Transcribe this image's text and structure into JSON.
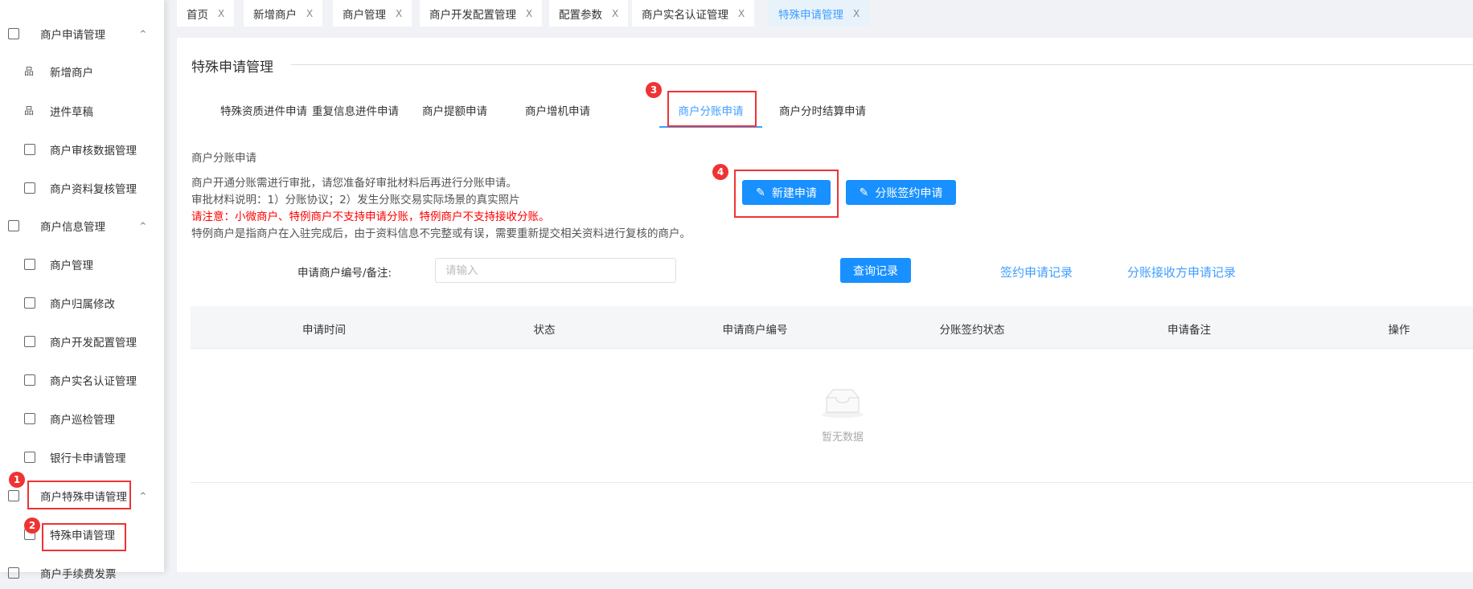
{
  "sidebar": {
    "items": [
      {
        "label": "商户申请管理",
        "type": "group"
      },
      {
        "label": "新增商户",
        "type": "sub"
      },
      {
        "label": "进件草稿",
        "type": "sub"
      },
      {
        "label": "商户审核数据管理",
        "type": "sub"
      },
      {
        "label": "商户资料复核管理",
        "type": "sub"
      },
      {
        "label": "商户信息管理",
        "type": "group"
      },
      {
        "label": "商户管理",
        "type": "sub"
      },
      {
        "label": "商户归属修改",
        "type": "sub"
      },
      {
        "label": "商户开发配置管理",
        "type": "sub"
      },
      {
        "label": "商户实名认证管理",
        "type": "sub"
      },
      {
        "label": "商户巡检管理",
        "type": "sub"
      },
      {
        "label": "银行卡申请管理",
        "type": "sub"
      },
      {
        "label": "商户特殊申请管理",
        "type": "group"
      },
      {
        "label": "特殊申请管理",
        "type": "sub"
      },
      {
        "label": "商户手续费发票",
        "type": "group"
      }
    ]
  },
  "tabs": [
    {
      "label": "首页"
    },
    {
      "label": "新增商户"
    },
    {
      "label": "商户管理"
    },
    {
      "label": "商户开发配置管理"
    },
    {
      "label": "配置参数"
    },
    {
      "label": "商户实名认证管理"
    },
    {
      "label": "特殊申请管理",
      "active": true
    }
  ],
  "tab_close": "X",
  "page": {
    "title": "特殊申请管理",
    "subtabs": [
      "特殊资质进件申请",
      "重复信息进件申请",
      "商户提额申请",
      "商户增机申请",
      "商户分账申请",
      "商户分时结算申请"
    ],
    "section_title": "商户分账申请",
    "notes": [
      "商户开通分账需进行审批，请您准备好审批材料后再进行分账申请。",
      "审批材料说明：1）分账协议；2）发生分账交易实际场景的真实照片",
      "请注意：小微商户、特例商户不支持申请分账，特例商户不支持接收分账。",
      "特例商户是指商户在入驻完成后，由于资料信息不完整或有误，需要重新提交相关资料进行复核的商户。"
    ],
    "new_button": "新建申请",
    "sign_button": "分账签约申请",
    "search_label": "申请商户编号/备注:",
    "search_placeholder": "请输入",
    "search_value": "",
    "query_button": "查询记录",
    "link_sign": "签约申请记录",
    "link_receiver": "分账接收方申请记录",
    "columns": [
      "申请时间",
      "状态",
      "申请商户编号",
      "分账签约状态",
      "申请备注",
      "操作"
    ],
    "empty": "暂无数据"
  },
  "annotations": [
    "1",
    "2",
    "3",
    "4"
  ],
  "colors": {
    "primary": "#1890ff",
    "warning": "#ff0000",
    "annotation": "#e33333"
  }
}
